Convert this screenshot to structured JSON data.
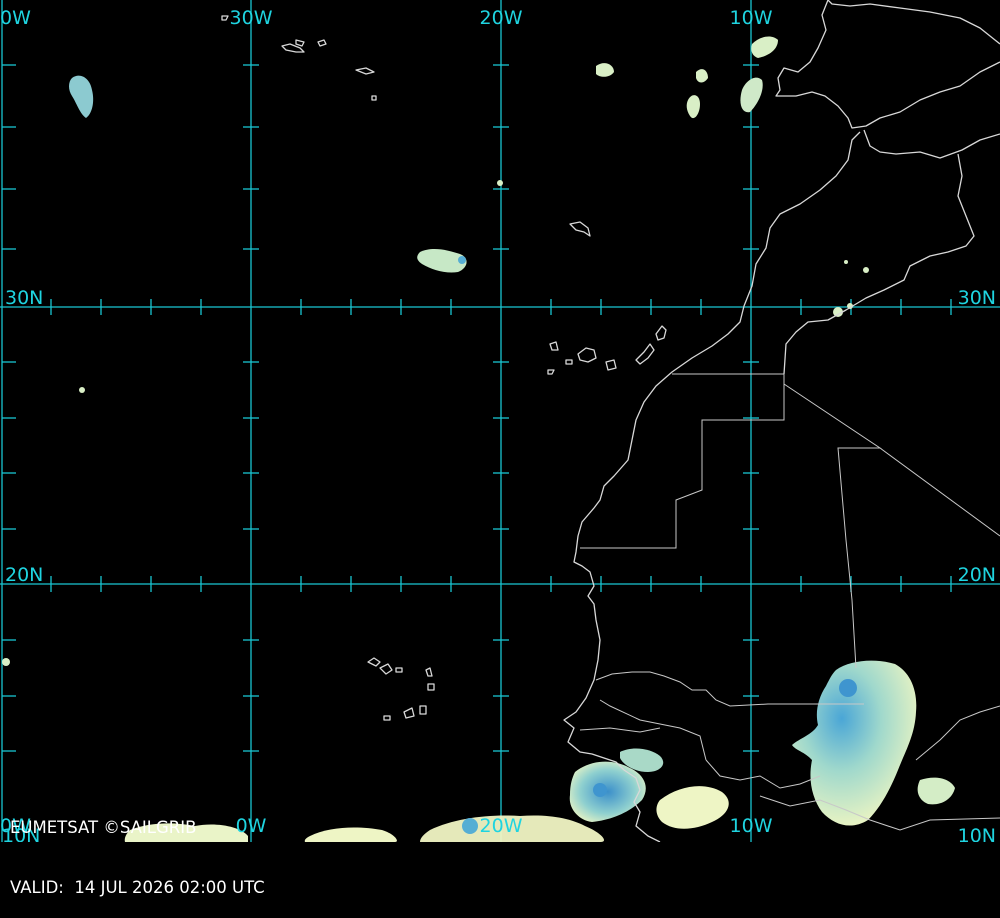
{
  "map": {
    "longitude_labels": [
      "0W",
      "30W",
      "20W",
      "10W"
    ],
    "latitude_labels": [
      "30N",
      "20N",
      "10N"
    ],
    "bottom_labels": [
      "0W",
      "0W",
      "20W",
      "10W",
      "10N",
      "10N"
    ]
  },
  "credits": {
    "source": "EUMETSAT ©SAILGRIB",
    "valid_label": "VALID:",
    "valid_time": "14 JUL 2026 02:00 UTC"
  },
  "colors": {
    "grid": "#19c5d2",
    "coast": "#d8d8d8",
    "cloud_light": "#f2f7c2",
    "cloud_mid": "#a7dcc4",
    "cloud_deep": "#3a9ad0"
  }
}
